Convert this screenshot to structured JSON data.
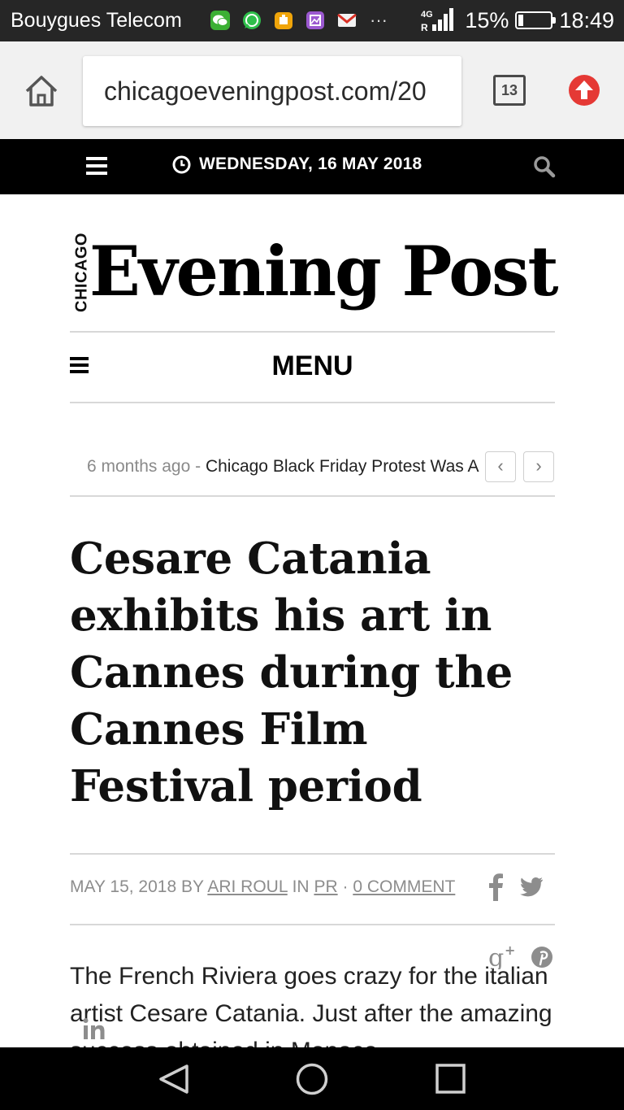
{
  "status_bar": {
    "carrier": "Bouygues Telecom",
    "notification_icons": [
      "wechat-icon",
      "whatsapp-icon",
      "package-icon",
      "gallery-icon",
      "gmail-icon"
    ],
    "overflow": "···",
    "network": "4G",
    "battery": "15%",
    "battery_level": 0.15,
    "time": "18:49"
  },
  "browser": {
    "url": "chicagoeveningpost.com/20",
    "tab_count": "13"
  },
  "site_header": {
    "date": "WEDNESDAY, 16 MAY 2018"
  },
  "masthead": {
    "city": "CHICAGO",
    "title": "Evening Post"
  },
  "menu": {
    "label": "MENU"
  },
  "ticker": {
    "ago": "6 months ago",
    "separator": " - ",
    "headline": "Chicago Black Friday Protest Was A",
    "prev": "‹",
    "next": "›"
  },
  "article": {
    "title": "Cesare Catania exhibits his art in Cannes during the Cannes Film Festival period",
    "date": "MAY 15, 2018",
    "by": "BY",
    "author": "ARI ROUL",
    "in": "IN",
    "category": "PR",
    "dot": "·",
    "comments": "0 COMMENT",
    "body": "The French Riviera goes crazy for the italian artist Cesare Catania. Just after the amazing success obtained in Monaco"
  },
  "colors": {
    "status_bar_bg": "#262626",
    "toolbar_bg": "#f1f1f1",
    "site_bar_bg": "#000000",
    "upload_red": "#e53935",
    "meta_gray": "#8d8d8d"
  }
}
